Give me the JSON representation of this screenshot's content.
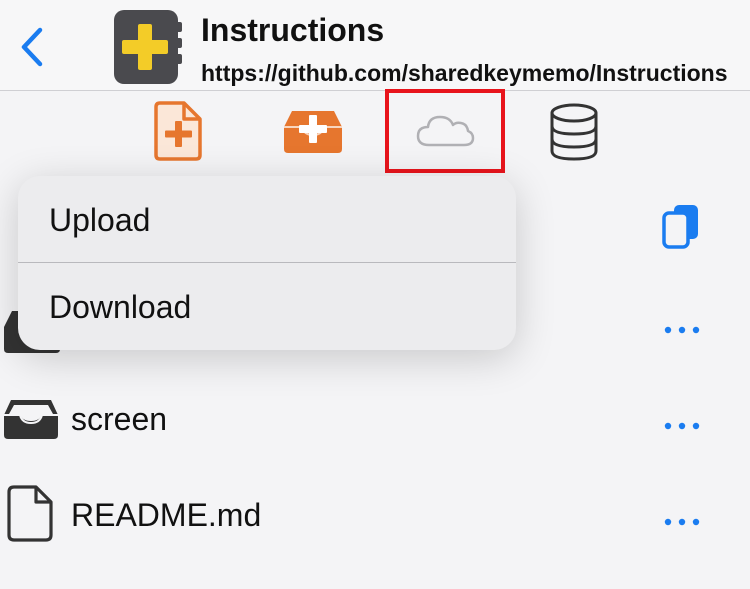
{
  "header": {
    "title": "Instructions",
    "subtitle": "https://github.com/sharedkeymemo/Instructions"
  },
  "toolbar": {
    "buttons": [
      {
        "icon": "new-file-icon",
        "color": "#e6762e"
      },
      {
        "icon": "new-folder-icon",
        "color": "#e6762e"
      },
      {
        "icon": "cloud-icon",
        "color": "#b0b0b4",
        "highlight": "#e8141c"
      },
      {
        "icon": "database-icon",
        "color": "#333333"
      }
    ]
  },
  "menu": {
    "items": [
      {
        "label": "Upload"
      },
      {
        "label": "Download"
      }
    ]
  },
  "files": [
    {
      "name": "screen",
      "type": "folder"
    },
    {
      "name": "README.md",
      "type": "file"
    }
  ],
  "colors": {
    "accent": "#1a7cf0",
    "orange": "#e6762e",
    "highlight": "#e8141c"
  }
}
